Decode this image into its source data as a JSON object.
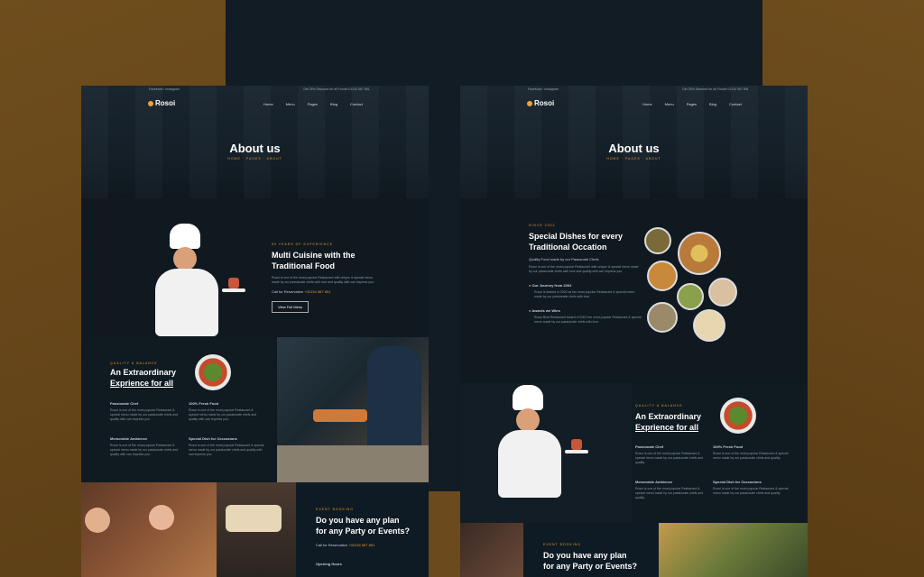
{
  "brand": {
    "name": "Rosoi",
    "accent": "#e59a3a"
  },
  "topbar": {
    "left": "Facebook / Instagram",
    "right": "Get 25% Discount for all Foods! 01234 567 891"
  },
  "nav": [
    "Home",
    "Menu",
    "Pages",
    "Blog",
    "Contact"
  ],
  "hero": {
    "title": "About us",
    "breadcrumb": "HOME · PAGES · ABOUT"
  },
  "left": {
    "about": {
      "eyebrow": "50 YEARS OF EXPERIENCE",
      "title_line1": "Multi Cuisine with the",
      "title_line2": "Traditional Food",
      "text": "Rosoi is one of the most popular Restaurant with unique & special menu made by our passionate chefs with love and quality with can impress you.",
      "call_label": "Call for Reservation",
      "phone": "+01234 567 891",
      "button": "View Full Menu"
    },
    "features": {
      "eyebrow": "QUALITY & BALANCE",
      "title_line1": "An Extraordinary",
      "title_line2": "Exprience for all",
      "items": [
        {
          "title": "Passionate Chef",
          "text": "Rosoi is one of the most popular Restaurant & special menu made by our passionate chefs and quality with can impress you."
        },
        {
          "title": "100% Fresh Food",
          "text": "Rosoi is one of the most popular Restaurant & special menu made by our passionate chefs and quality with can impress you."
        },
        {
          "title": "Memorable Ambience",
          "text": "Rosoi is one of the most popular Restaurant & special menu made by our passionate chefs and quality with can impress you."
        },
        {
          "title": "Special Dish for Occcasions",
          "text": "Rosoi is one of the most popular Restaurant & special menu made by our passionate chefs and quality with can impress you."
        }
      ]
    },
    "event": {
      "eyebrow": "EVENT BOOKING",
      "title_line1": "Do you have any plan",
      "title_line2": "for any Party or Events?",
      "call_label": "Call for Reservation",
      "phone": "+01234 567 891",
      "hours": "Opening Hours"
    }
  },
  "right": {
    "special": {
      "eyebrow": "SINCE 2002",
      "title_line1": "Special Dishes for every",
      "title_line2": "Traditional Occation",
      "subtitle": "Quality Food made by our Passonate Chefs",
      "text": "Rosoi is one of the most popular Restaurant with unique & special menu made by our passionate chefs with love and quality with can impress you.",
      "journey_title": "Our Journey from 2002",
      "journey_text": "Rosoi is started in 2002 as the most popular Restaurant & special menu made by our passionate chefs with love.",
      "awards_title": "Awards we Wins",
      "awards_text": "Rosoi Best Restaurant Award of 2002 the most popular Restaurant & special menu made by our passionate chefs with love."
    },
    "features": {
      "eyebrow": "QUALITY & BALANCE",
      "title_line1": "An Extraordinary",
      "title_line2": "Exprience for all",
      "items": [
        {
          "title": "Passionate Chef",
          "text": "Rosoi is one of the most popular Restaurant & special menu made by our passionate chefs and quality."
        },
        {
          "title": "100% Fresh Food",
          "text": "Rosoi is one of the most popular Restaurant & special menu made by our passionate chefs and quality."
        },
        {
          "title": "Memorable Ambience",
          "text": "Rosoi is one of the most popular Restaurant & special menu made by our passionate chefs and quality."
        },
        {
          "title": "Special Dish for Occcasions",
          "text": "Rosoi is one of the most popular Restaurant & special menu made by our passionate chefs and quality."
        }
      ]
    },
    "event": {
      "eyebrow": "EVENT BOOKING",
      "title_line1": "Do you have any plan",
      "title_line2": "for any Party or Events?"
    }
  }
}
